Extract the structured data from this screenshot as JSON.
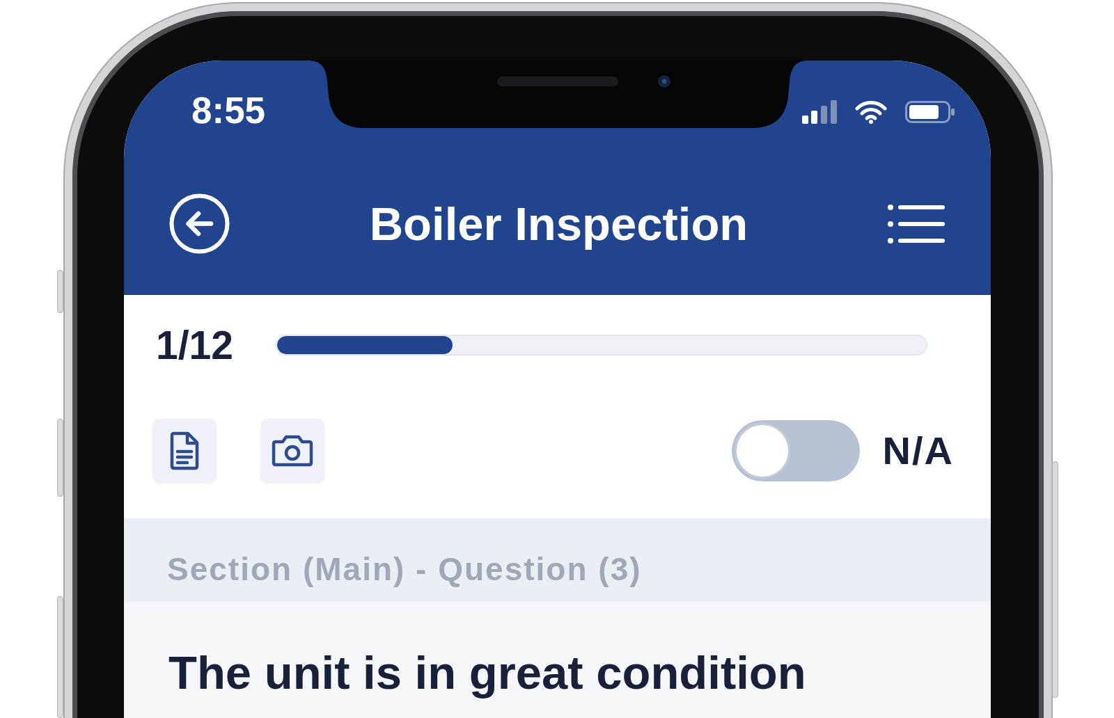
{
  "status_bar": {
    "time": "8:55"
  },
  "header": {
    "title": "Boiler Inspection"
  },
  "progress": {
    "label": "1/12",
    "level": 0.27
  },
  "toolbar": {
    "na_toggle": {
      "label": "N/A",
      "on": false
    }
  },
  "section": {
    "heading": "Section (Main) - Question (3)"
  },
  "question": {
    "text": "The unit is in great condition"
  }
}
